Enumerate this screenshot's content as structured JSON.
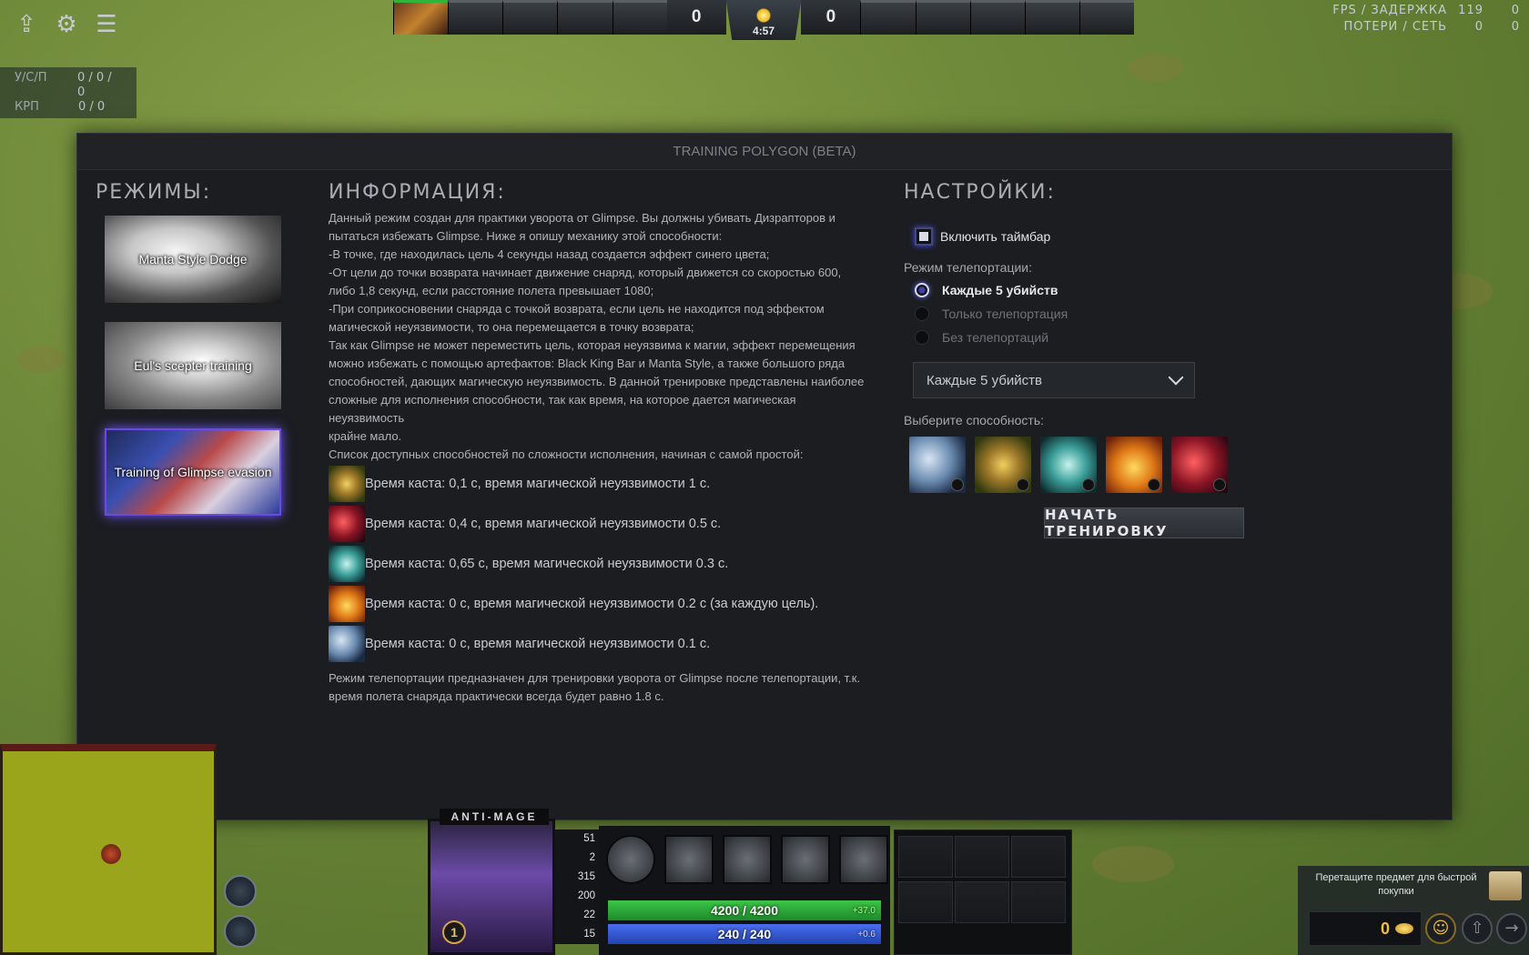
{
  "topbar": {
    "icons": [
      "upload-icon",
      "gear-icon",
      "menu-icon"
    ],
    "score_radiant": "0",
    "score_dire": "0",
    "clock": "4:57",
    "fps_label": "FPS / ЗАДЕРЖКА",
    "fps_value": "119",
    "fps_extra": "0",
    "loss_label": "ПОТЕРИ / СЕТЬ",
    "loss_value": "0",
    "loss_extra": "0"
  },
  "kda": {
    "kda_label": "У/С/П",
    "kda_value": "0 / 0 / 0",
    "cs_label": "КРП",
    "cs_value": "0 / 0"
  },
  "panel": {
    "title": "TRAINING POLYGON (BETA)",
    "modes_heading": "РЕЖИМЫ:",
    "modes": [
      "Manta Style Dodge",
      "Eul's scepter training",
      "Training of Glimpse evasion"
    ],
    "info_heading": "ИНФОРМАЦИЯ:",
    "info_text": "Данный режим создан для практики уворота от Glimpse. Вы должны убивать Дизрапторов и\nпытаться избежать Glimpse. Ниже я опишу механику этой способности:\n-В точке, где находилась цель 4 секунды назад создается эффект синего цвета;\n-От цели до точки возврата начинает движение снаряд, который движется со скоростью 600,\nлибо 1,8 секунд, если расстояние полета превышает 1080;\n-При соприкосновении снаряда с точкой возврата, если цель не находится под эффектом\nмагической неуязвимости, то она перемещается в точку возврата;\nТак как Glimpse не может переместить цель, которая неуязвима к магии, эффект перемещения\nможно избежать с помощью артефактов: Black King Bar и Manta Style, а также большого ряда\nспособностей, дающих магическую неуязвимость. В данной тренировке представлены наиболее\nсложные для исполнения способности, так как время, на которое дается магическая неуязвимость\nкрайне мало.\nСписок доступных способностей по сложности исполнения, начиная с самой простой:",
    "ability_list": [
      {
        "icon": "bkb-icon",
        "text": "Время каста: 0,1 с, время магической неуязвимости 1 с."
      },
      {
        "icon": "rider-icon",
        "text": "Время каста: 0,4 с, время магической неуязвимости 0.5 с."
      },
      {
        "icon": "manta-icon",
        "text": "Время каста: 0,65 с, время магической неуязвимости 0.3 с."
      },
      {
        "icon": "fist-icon",
        "text": "Время каста: 0 с, время магической неуязвимости 0.2 с (за каждую цель)."
      },
      {
        "icon": "glimpse-icon",
        "text": "Время каста: 0 с, время магической неуязвимости 0.1 с."
      }
    ],
    "info_tail": "Режим телепортации предназначен для тренировки уворота от Glimpse после телепортации, т.к.\nвремя полета снаряда практически всегда будет равно 1.8 с.",
    "settings_heading": "НАСТРОЙКИ:",
    "timebar_label": "Включить таймбар",
    "teleport_label": "Режим телепортации:",
    "teleport_options": [
      "Каждые 5 убийств",
      "Только телепортация",
      "Без телепортаций"
    ],
    "teleport_selected": "Каждые 5 убийств",
    "choose_ability_label": "Выберите способность:",
    "start_button": "НАЧАТЬ ТРЕНИРОВКУ"
  },
  "hud": {
    "hero_name": "ANTI-MAGE",
    "level": "1",
    "stats": [
      "51",
      "2",
      "315",
      "200",
      "22",
      "15"
    ],
    "hp_text": "4200 / 4200",
    "hp_regen": "+37.0",
    "mana_text": "240 / 240",
    "mana_regen": "+0.6",
    "shop_hint": "Перетащите предмет для быстрой покупки",
    "gold": "0"
  },
  "colors": {
    "panel_bg": "#1b1d21",
    "hp": "#3dc548",
    "mana": "#4a6ef0",
    "selected_glow": "#6a4adf"
  }
}
